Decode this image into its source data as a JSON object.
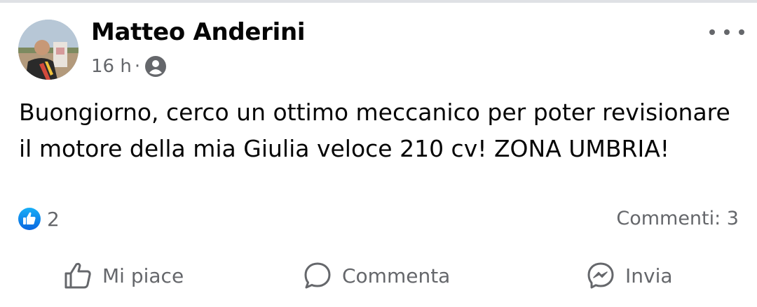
{
  "post": {
    "author": "Matteo Anderini",
    "time": "16 h",
    "separator": "·",
    "audience_icon": "friends-audience-icon",
    "text": "Buongiorno, cerco un ottimo meccanico per poter revisionare il motore della mia Giulia veloce 210 cv! ZONA UMBRIA!"
  },
  "stats": {
    "reaction_count": "2",
    "reaction_icon": "like-reaction-icon",
    "comments_label": "Commenti: 3"
  },
  "actions": {
    "like_label": "Mi piace",
    "comment_label": "Commenta",
    "send_label": "Invia"
  },
  "colors": {
    "like_blue": "#1877f2",
    "secondary_text": "#65676b",
    "primary_text": "#050505"
  }
}
